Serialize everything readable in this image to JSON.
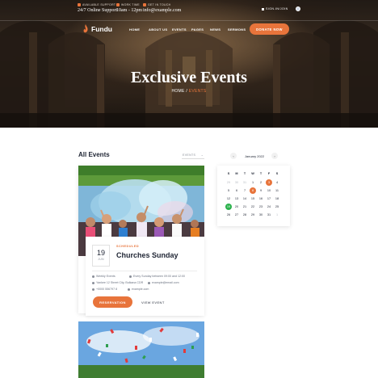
{
  "topbar": {
    "support_label": "AVAILABLE SUPPORT",
    "support_value": "24/7 Online Support",
    "worktime_label": "WORK TIME",
    "worktime_value": "10am - 12pm",
    "contact_label": "GET IN TOUCH",
    "contact_value": "info@example.com",
    "signin_label": "SIGN-IN/JOIN"
  },
  "header": {
    "logo_text": "Fundu",
    "nav": [
      "HOME",
      "ABOUT US",
      "EVENTS",
      "PAGES",
      "NEWS",
      "SERMONS"
    ],
    "donate_label": "DONATE NOW"
  },
  "hero": {
    "title": "Exclusive Events",
    "crumb_home": "HOME",
    "crumb_sep": " / ",
    "crumb_current": "EVENTS"
  },
  "events": {
    "section_title": "All Events",
    "filter_label": "EVENTS",
    "filter_icon": "chevron-down-icon",
    "card": {
      "day": "19",
      "month": "JUN",
      "kicker": "SCHEDULED",
      "title": "Churches Sunday",
      "meta_frequency": "Weekly Events",
      "meta_time": "Every Sunday between 09:00 and 12:00",
      "meta_address": "Yankee 12 Street City, Bulkana CDR",
      "meta_email": "example@email.com",
      "meta_phone": "+0000 556797 8",
      "meta_web": "example.com",
      "reservation_label": "RESERVATION",
      "view_label": "VIEW EVENT"
    }
  },
  "calendar": {
    "month_label": "January 2022",
    "prev_icon": "chevron-left-icon",
    "next_icon": "chevron-right-icon",
    "weekdays": [
      "S",
      "M",
      "T",
      "W",
      "T",
      "F",
      "S"
    ],
    "weeks": [
      [
        "29",
        "30",
        "31",
        "1",
        "2",
        "3",
        "4"
      ],
      [
        "5",
        "6",
        "7",
        "8",
        "9",
        "10",
        "11"
      ],
      [
        "12",
        "13",
        "14",
        "15",
        "16",
        "17",
        "18"
      ],
      [
        "19",
        "20",
        "21",
        "22",
        "23",
        "24",
        "25"
      ],
      [
        "26",
        "27",
        "28",
        "29",
        "30",
        "31",
        "1"
      ]
    ],
    "event_days": [
      "3",
      "8"
    ],
    "today": "19"
  },
  "colors": {
    "accent": "#e8743b",
    "today": "#2bb24c",
    "heading": "#1e2433"
  }
}
